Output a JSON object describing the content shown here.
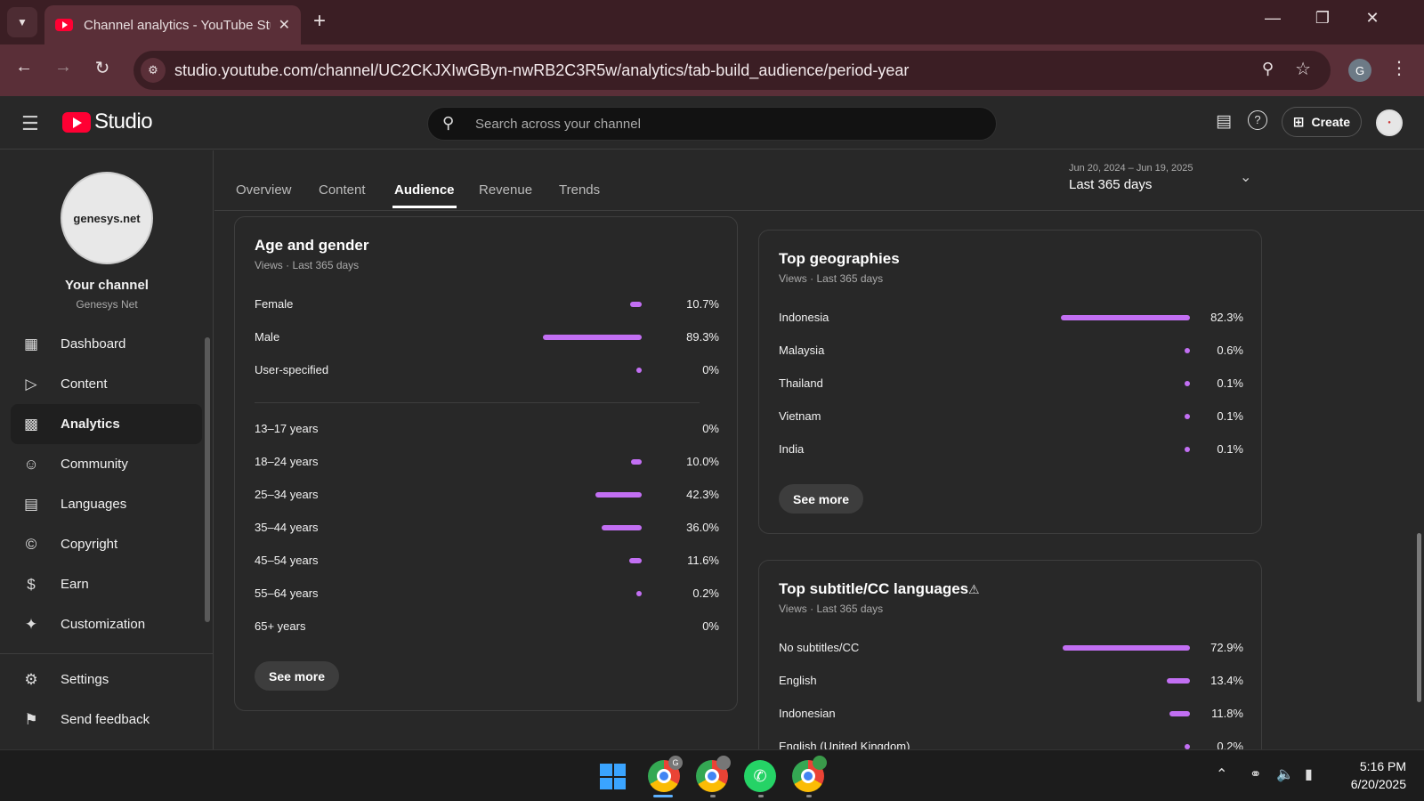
{
  "browser": {
    "tab_title": "Channel analytics - YouTube Studio",
    "url": "studio.youtube.com/channel/UC2CKJXIwGByn-nwRB2C3R5w/analytics/tab-build_audience/period-year",
    "profile_initial": "G",
    "colors": {
      "tabbar": "#3b1e24",
      "toolbar": "#5a2f38"
    }
  },
  "header": {
    "logo_text": "Studio",
    "search_placeholder": "Search across your channel",
    "create_label": "Create"
  },
  "sidebar": {
    "channel_logo_text": "genesys.net",
    "channel_title": "Your channel",
    "channel_name": "Genesys Net",
    "items": [
      {
        "label": "Dashboard",
        "icon": "dashboard-icon"
      },
      {
        "label": "Content",
        "icon": "content-icon"
      },
      {
        "label": "Analytics",
        "icon": "analytics-icon",
        "active": true
      },
      {
        "label": "Community",
        "icon": "community-icon"
      },
      {
        "label": "Languages",
        "icon": "languages-icon"
      },
      {
        "label": "Copyright",
        "icon": "copyright-icon"
      },
      {
        "label": "Earn",
        "icon": "earn-icon"
      },
      {
        "label": "Customization",
        "icon": "customization-icon"
      }
    ],
    "bottom_items": [
      {
        "label": "Settings",
        "icon": "settings-icon"
      },
      {
        "label": "Send feedback",
        "icon": "feedback-icon"
      }
    ]
  },
  "analytics": {
    "tabs": [
      "Overview",
      "Content",
      "Audience",
      "Revenue",
      "Trends"
    ],
    "active_tab": "Audience",
    "date_range": "Jun 20, 2024 – Jun 19, 2025",
    "period_label": "Last 365 days"
  },
  "age_gender": {
    "title": "Age and gender",
    "subtitle": "Views · Last 365 days",
    "gender": [
      {
        "label": "Female",
        "value": "10.7%",
        "pct": 10.7
      },
      {
        "label": "Male",
        "value": "89.3%",
        "pct": 89.3
      },
      {
        "label": "User-specified",
        "value": "0%",
        "pct": 0
      }
    ],
    "ages": [
      {
        "label": "13–17 years",
        "value": "0%",
        "pct": 0,
        "dot": false
      },
      {
        "label": "18–24 years",
        "value": "10.0%",
        "pct": 10.0,
        "dot": true
      },
      {
        "label": "25–34 years",
        "value": "42.3%",
        "pct": 42.3,
        "dot": true
      },
      {
        "label": "35–44 years",
        "value": "36.0%",
        "pct": 36.0,
        "dot": true
      },
      {
        "label": "45–54 years",
        "value": "11.6%",
        "pct": 11.6,
        "dot": true
      },
      {
        "label": "55–64 years",
        "value": "0.2%",
        "pct": 0.2,
        "dot": true
      },
      {
        "label": "65+ years",
        "value": "0%",
        "pct": 0,
        "dot": false
      }
    ],
    "see_more": "See more"
  },
  "geographies": {
    "title": "Top geographies",
    "subtitle": "Views · Last 365 days",
    "rows": [
      {
        "label": "Indonesia",
        "value": "82.3%",
        "pct": 82.3
      },
      {
        "label": "Malaysia",
        "value": "0.6%",
        "pct": 0.6
      },
      {
        "label": "Thailand",
        "value": "0.1%",
        "pct": 0.1
      },
      {
        "label": "Vietnam",
        "value": "0.1%",
        "pct": 0.1
      },
      {
        "label": "India",
        "value": "0.1%",
        "pct": 0.1
      }
    ],
    "see_more": "See more"
  },
  "subtitles": {
    "title": "Top subtitle/CC languages",
    "subtitle": "Views · Last 365 days",
    "rows": [
      {
        "label": "No subtitles/CC",
        "value": "72.9%",
        "pct": 72.9
      },
      {
        "label": "English",
        "value": "13.4%",
        "pct": 13.4
      },
      {
        "label": "Indonesian",
        "value": "11.8%",
        "pct": 11.8
      },
      {
        "label": "English (United Kingdom)",
        "value": "0.2%",
        "pct": 0.2
      }
    ]
  },
  "bar_color": "#c26ff3",
  "taskbar": {
    "time": "5:16 PM",
    "date": "6/20/2025"
  }
}
